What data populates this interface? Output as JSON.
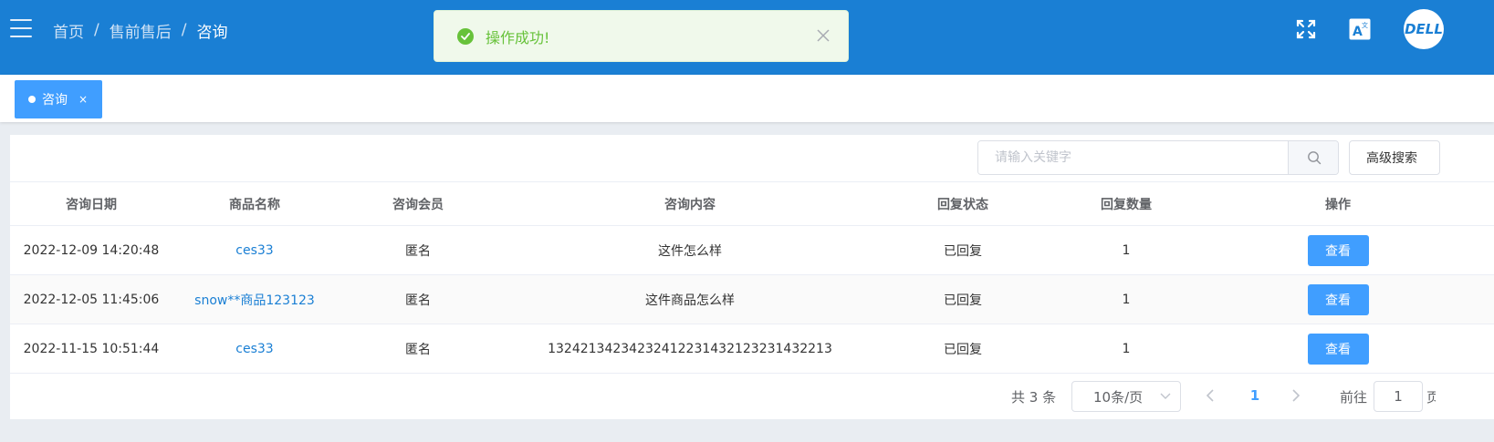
{
  "header": {
    "breadcrumb": [
      "首页",
      "售前售后",
      "咨询"
    ],
    "separator": "/",
    "avatar_text": "DELL",
    "icons": [
      "menu-icon",
      "fullscreen-icon",
      "translate-icon"
    ]
  },
  "toast": {
    "text": "操作成功!",
    "icon": "success-check-icon",
    "color": "#67c23a"
  },
  "tags": [
    {
      "label": "咨询",
      "close": "×"
    }
  ],
  "toolbar": {
    "search_placeholder": "请输入关键字",
    "advanced_search_label": "高级搜索"
  },
  "table": {
    "headers": [
      "咨询日期",
      "商品名称",
      "咨询会员",
      "咨询内容",
      "回复状态",
      "回复数量",
      "操作"
    ],
    "rows": [
      {
        "date": "2022-12-09 14:20:48",
        "product": "ces33",
        "member": "匿名",
        "content": "这件怎么样",
        "status": "已回复",
        "count": "1",
        "action": "查看"
      },
      {
        "date": "2022-12-05 11:45:06",
        "product": "snow**商品123123",
        "member": "匿名",
        "content": "这件商品怎么样",
        "status": "已回复",
        "count": "1",
        "action": "查看"
      },
      {
        "date": "2022-11-15 10:51:44",
        "product": "ces33",
        "member": "匿名",
        "content": "13242134234232412231432123231432213",
        "status": "已回复",
        "count": "1",
        "action": "查看"
      }
    ]
  },
  "pagination": {
    "total": "共 3 条",
    "page_size": "10条/页",
    "current_page": "1",
    "goto_label": "前往",
    "goto_value": "1",
    "page_suffix": "页"
  },
  "colors": {
    "header_bg": "#1a7fd4",
    "primary": "#409eff",
    "link": "#1a7fd4",
    "success": "#67c23a"
  }
}
